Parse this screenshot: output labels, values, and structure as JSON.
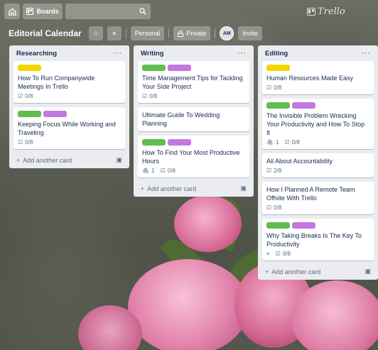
{
  "topbar": {
    "home_icon": "home-icon",
    "boards_label": "Boards",
    "search_icon": "search-icon",
    "logo": "Trello"
  },
  "board": {
    "title": "Editorial Calendar",
    "visibility_team": "Personal",
    "visibility": "Private",
    "avatar": "AM",
    "invite": "Invite"
  },
  "colors": {
    "green": "#61bd4f",
    "purple": "#c377e0",
    "yellow": "#f2d600"
  },
  "lists": [
    {
      "title": "Researching",
      "add_label": "Add another card",
      "cards": [
        {
          "title": "How To Run Companywide Meetings In Trello",
          "checklist": "0/8"
        },
        {
          "title": "Keeping Focus While Working and Traveling",
          "checklist": "0/8"
        }
      ]
    },
    {
      "title": "Writing",
      "add_label": "Add another card",
      "cards": [
        {
          "title": "Time Management Tips for Tackling Your Side Project",
          "checklist": "0/8"
        },
        {
          "title": "Ultimate Guide To Wedding Planning"
        },
        {
          "title": "How To Find Your Most Productive Hours",
          "attachments": "1",
          "checklist": "0/8"
        }
      ]
    },
    {
      "title": "Editing",
      "add_label": "Add another card",
      "cards": [
        {
          "title": "Human Resources Made Easy",
          "checklist": "0/8"
        },
        {
          "title": "The Invisible Problem Wrecking Your Productivity and How To Stop It",
          "attachments": "1",
          "checklist": "0/8"
        },
        {
          "title": "All About Accountability",
          "checklist": "2/8"
        },
        {
          "title": "How I Planned A Remote Team Offsite With Trello",
          "checklist": "0/8"
        },
        {
          "title": "Why Taking Breaks Is The Key To Productivity",
          "checklist": "0/8"
        }
      ]
    }
  ]
}
